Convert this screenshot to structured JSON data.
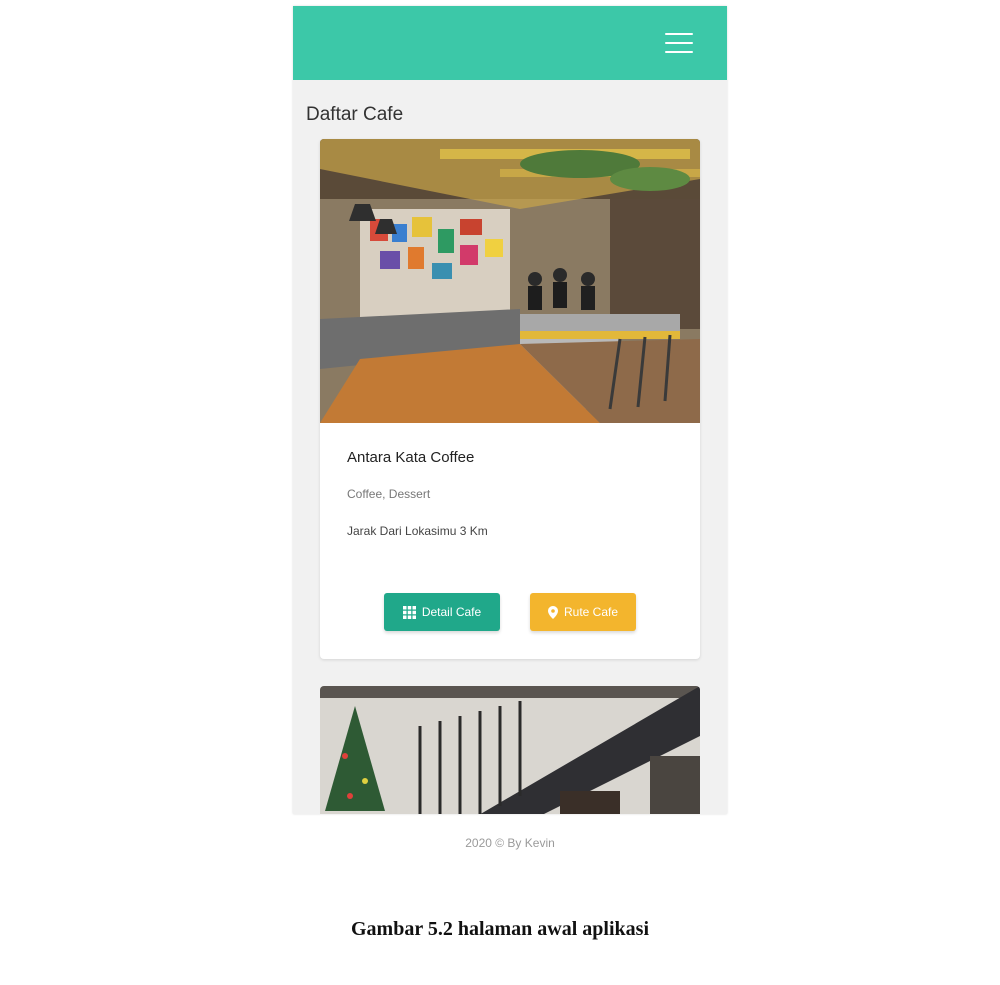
{
  "header": {
    "menu_icon": "hamburger-menu-icon",
    "bg_color": "#3cc8a8"
  },
  "page_title": "Daftar Cafe",
  "cafes": [
    {
      "name": "Antara Kata Coffee",
      "tags": "Coffee, Dessert",
      "distance": "Jarak Dari Lokasimu 3 Km",
      "detail_button": {
        "label": "Detail Cafe",
        "icon": "grid-icon",
        "color": "#20a88a"
      },
      "route_button": {
        "label": "Rute Cafe",
        "icon": "map-pin-icon",
        "color": "#f3b52d"
      }
    }
  ],
  "footer": "2020 © By Kevin",
  "caption": "Gambar 5.2 halaman awal aplikasi"
}
